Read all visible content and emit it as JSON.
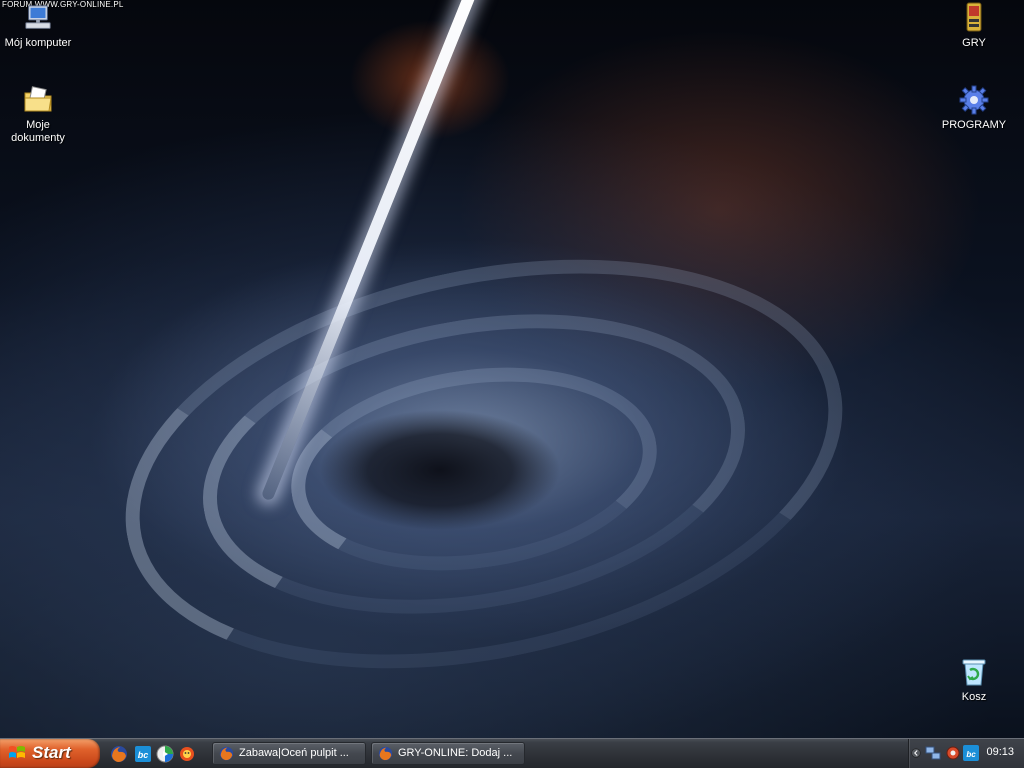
{
  "watermark": "FORUM WWW.GRY-ONLINE.PL",
  "desktop_icons": {
    "my_computer": "Mój komputer",
    "my_documents": "Moje dokumenty",
    "gry": "GRY",
    "programy": "PROGRAMY",
    "recycle_bin": "Kosz"
  },
  "taskbar": {
    "start_label": "Start",
    "quick_launch": [
      "firefox-icon",
      "bc-icon",
      "media-player-icon",
      "messenger-icon"
    ],
    "tasks": [
      {
        "label": "Zabawa|Oceń pulpit ...",
        "icon": "firefox-icon"
      },
      {
        "label": "GRY-ONLINE: Dodaj ...",
        "icon": "firefox-icon"
      }
    ],
    "tray_icons": [
      "chevron-left-icon",
      "network-icon",
      "gear-icon",
      "bc-icon"
    ],
    "clock": "09:13"
  },
  "colors": {
    "start_orange": "#e0622c",
    "taskbar_gray": "#2d3036",
    "firefox_orange": "#e8761e",
    "bc_blue": "#1b8fd8"
  }
}
